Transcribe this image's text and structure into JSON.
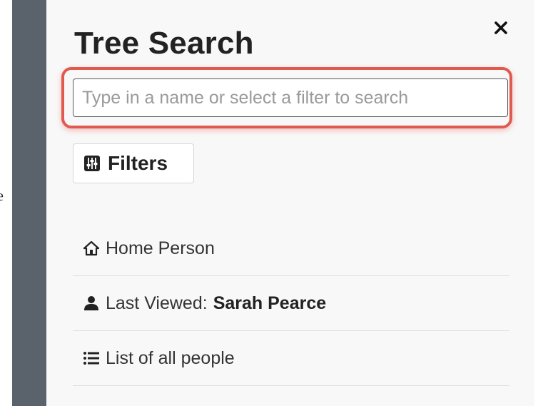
{
  "page": {
    "left_edge_fragment": "e"
  },
  "panel": {
    "title": "Tree Search",
    "close_icon": "close-icon",
    "search": {
      "placeholder": "Type in a name or select a filter to search",
      "value": "",
      "highlight_color": "#e05a4f"
    },
    "filters_button": {
      "label": "Filters",
      "icon": "sliders-icon"
    },
    "items": [
      {
        "icon": "home-icon",
        "label": "Home Person",
        "value": ""
      },
      {
        "icon": "user-icon",
        "label": "Last Viewed:",
        "value": "Sarah Pearce"
      },
      {
        "icon": "list-icon",
        "label": "List of all people",
        "value": ""
      }
    ]
  },
  "colors": {
    "sidebar_bar": "#5a626b",
    "panel_bg": "#f8f8f8",
    "divider": "#dedede"
  }
}
